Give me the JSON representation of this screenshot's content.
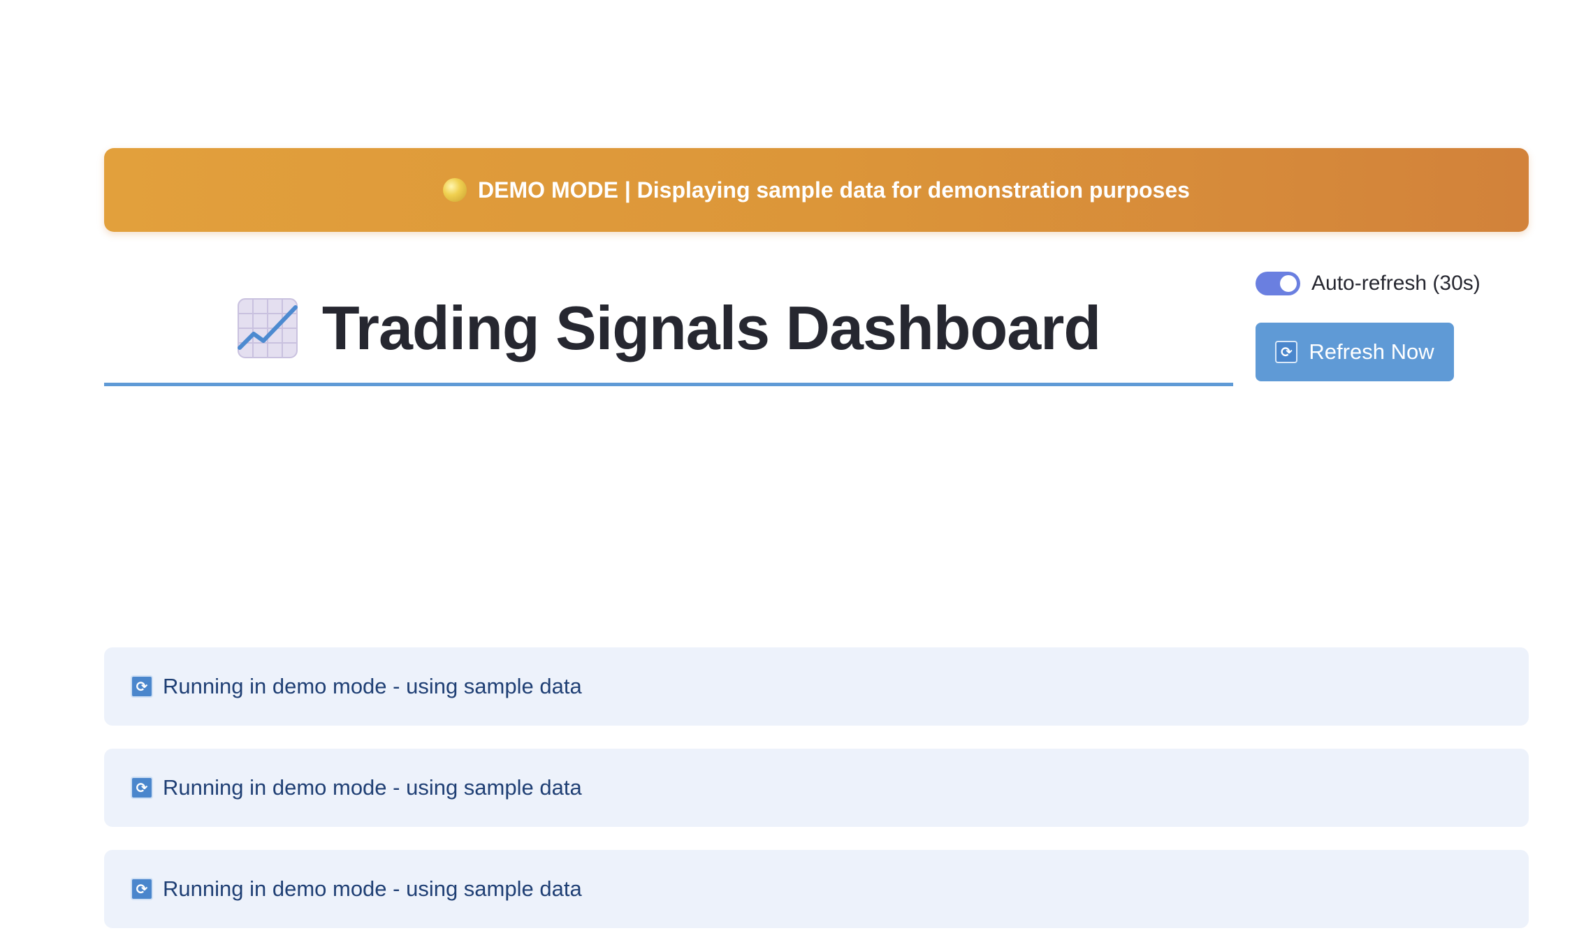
{
  "banner": {
    "text": "DEMO MODE | Displaying sample data for demonstration purposes",
    "icon": "yellow-circle-icon"
  },
  "header": {
    "title": "Trading Signals Dashboard",
    "icon": "chart-increasing-icon"
  },
  "controls": {
    "auto_refresh_label": "Auto-refresh (30s)",
    "auto_refresh_on": true,
    "refresh_button_label": "Refresh Now",
    "refresh_icon": "arrows-refresh-icon"
  },
  "status_messages": [
    {
      "text": "Running in demo mode - using sample data",
      "icon": "arrows-refresh-icon"
    },
    {
      "text": "Running in demo mode - using sample data",
      "icon": "arrows-refresh-icon"
    },
    {
      "text": "Running in demo mode - using sample data",
      "icon": "arrows-refresh-icon"
    }
  ],
  "colors": {
    "banner_start": "#e2a03c",
    "banner_end": "#d2823a",
    "accent": "#5f9ad6",
    "toggle": "#6a7fe0",
    "info_background": "#edf2fb",
    "info_text": "#1f3f74"
  }
}
